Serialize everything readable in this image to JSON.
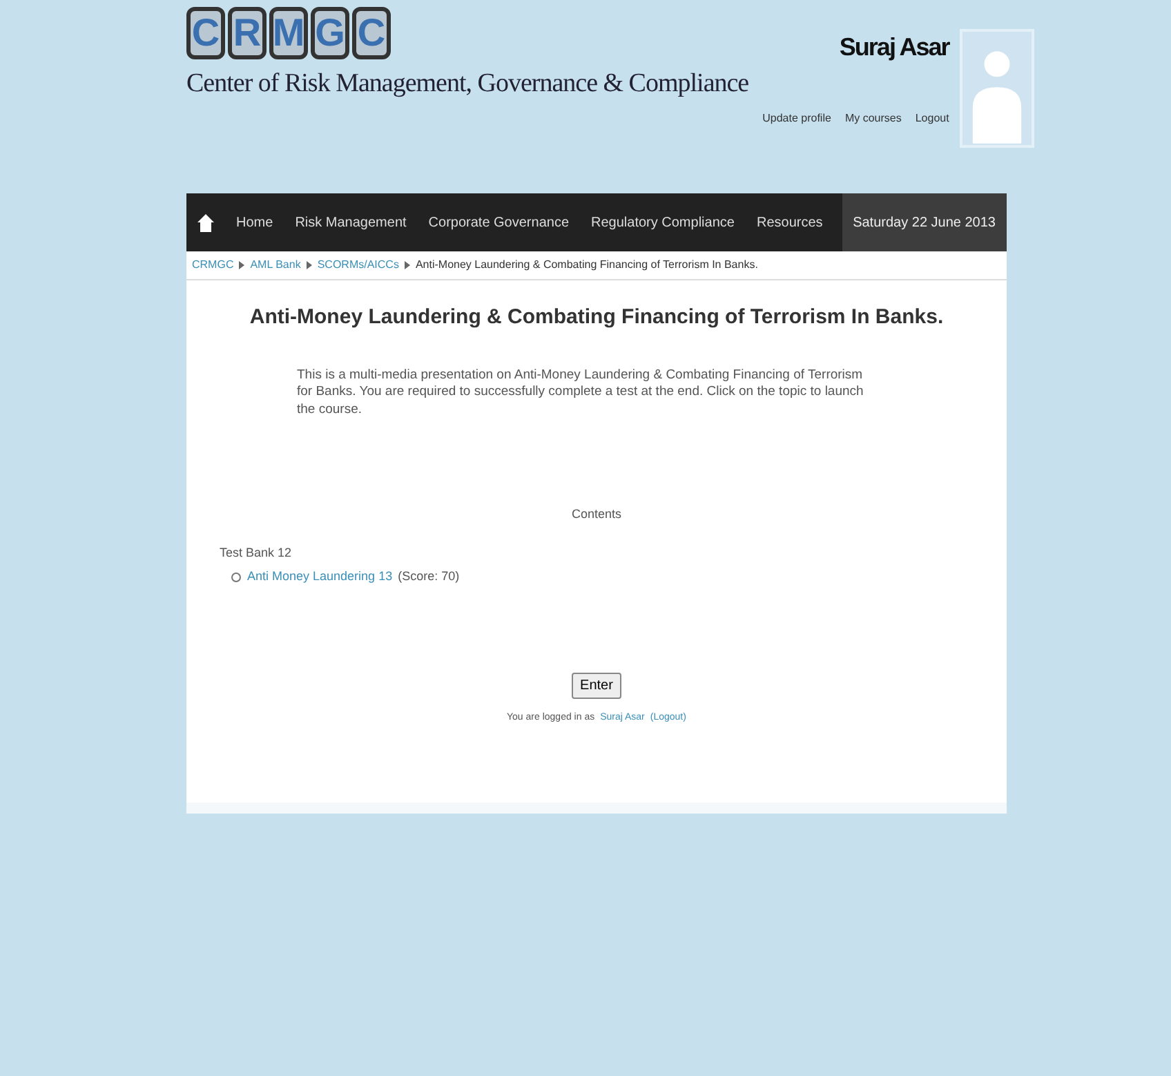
{
  "header": {
    "logo_letters": [
      "C",
      "R",
      "M",
      "G",
      "C"
    ],
    "site_title": "Center of Risk Management, Governance & Compliance",
    "user_name": "Suraj Asar",
    "user_links": [
      "Update profile",
      "My courses",
      "Logout"
    ]
  },
  "navbar": {
    "items": [
      "Home",
      "Risk Management",
      "Corporate Governance",
      "Regulatory Compliance",
      "Resources"
    ],
    "date": "Saturday 22 June 2013"
  },
  "breadcrumb": [
    {
      "label": "CRMGC",
      "kind": "link"
    },
    {
      "label": "AML Bank",
      "kind": "link"
    },
    {
      "label": "SCORMs/AICCs",
      "kind": "link"
    },
    {
      "label": "Anti-Money Laundering & Combating Financing of Terrorism In Banks.",
      "kind": "current"
    }
  ],
  "course": {
    "title": "Anti-Money Laundering & Combating Financing of Terrorism In Banks.",
    "description": "This is a multi-media presentation on Anti-Money Laundering & Combating Financing of Terrorism for Banks. You are required to successfully complete a test at the end. Click on the topic to launch the course.",
    "contents_heading": "Contents",
    "tree": [
      {
        "label": "Test Bank 12",
        "children": [
          {
            "label": "Anti Money Laundering 13",
            "score": "(Score: 70)"
          }
        ]
      }
    ],
    "enter_button": "Enter"
  },
  "footer": {
    "prefix": "You are logged in as",
    "user": "Suraj Asar",
    "logout": "(Logout)"
  }
}
